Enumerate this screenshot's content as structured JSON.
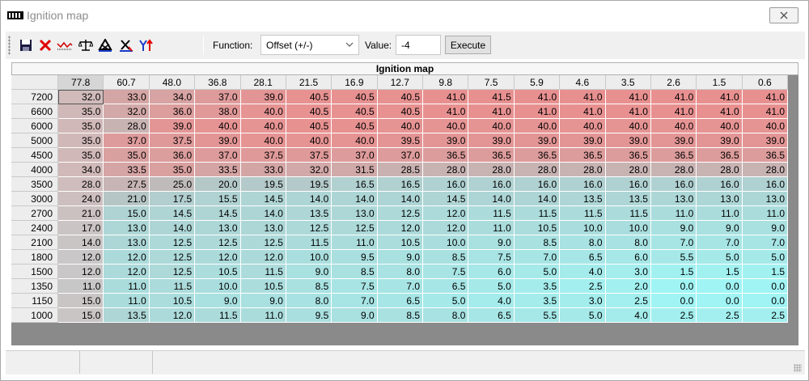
{
  "window": {
    "title": "Ignition map",
    "close_label": "✕"
  },
  "toolbar": {
    "icons": [
      "save-icon",
      "delete-icon",
      "graph-icon",
      "balance-icon",
      "interpolate-x-icon",
      "interpolate-xy-icon",
      "interpolate-y-icon"
    ],
    "function_label": "Function:",
    "function_selected": "Offset (+/-)",
    "value_label": "Value:",
    "value": "-4",
    "execute_label": "Execute"
  },
  "grid": {
    "title": "Ignition map",
    "columns": [
      "77.8",
      "60.7",
      "48.0",
      "36.8",
      "28.1",
      "21.5",
      "16.9",
      "12.7",
      "9.8",
      "7.5",
      "5.9",
      "4.6",
      "3.5",
      "2.6",
      "1.5",
      "0.6"
    ],
    "rows": [
      {
        "rpm": "7200",
        "values": [
          "32.0",
          "33.0",
          "34.0",
          "37.0",
          "39.0",
          "40.5",
          "40.5",
          "40.5",
          "41.0",
          "41.5",
          "41.0",
          "41.0",
          "41.0",
          "41.0",
          "41.0",
          "41.0"
        ]
      },
      {
        "rpm": "6600",
        "values": [
          "35.0",
          "32.0",
          "36.0",
          "38.0",
          "40.0",
          "40.5",
          "40.5",
          "40.5",
          "41.0",
          "41.0",
          "41.0",
          "41.0",
          "41.0",
          "41.0",
          "41.0",
          "41.0"
        ]
      },
      {
        "rpm": "6000",
        "values": [
          "35.0",
          "28.0",
          "39.0",
          "40.0",
          "40.0",
          "40.5",
          "40.5",
          "40.0",
          "40.0",
          "40.0",
          "40.0",
          "40.0",
          "40.0",
          "40.0",
          "40.0",
          "40.0"
        ]
      },
      {
        "rpm": "5000",
        "values": [
          "35.0",
          "37.0",
          "37.5",
          "39.0",
          "40.0",
          "40.0",
          "40.0",
          "39.5",
          "39.0",
          "39.0",
          "39.0",
          "39.0",
          "39.0",
          "39.0",
          "39.0",
          "39.0"
        ]
      },
      {
        "rpm": "4500",
        "values": [
          "35.0",
          "35.0",
          "36.0",
          "37.0",
          "37.5",
          "37.5",
          "37.0",
          "37.0",
          "36.5",
          "36.5",
          "36.5",
          "36.5",
          "36.5",
          "36.5",
          "36.5",
          "36.5"
        ]
      },
      {
        "rpm": "4000",
        "values": [
          "34.0",
          "33.5",
          "35.0",
          "33.5",
          "33.0",
          "32.0",
          "31.5",
          "28.5",
          "28.0",
          "28.0",
          "28.0",
          "28.0",
          "28.0",
          "28.0",
          "28.0",
          "28.0"
        ]
      },
      {
        "rpm": "3500",
        "values": [
          "28.0",
          "27.5",
          "25.0",
          "20.0",
          "19.5",
          "19.5",
          "16.5",
          "16.5",
          "16.0",
          "16.0",
          "16.0",
          "16.0",
          "16.0",
          "16.0",
          "16.0",
          "16.0"
        ]
      },
      {
        "rpm": "3000",
        "values": [
          "24.0",
          "21.0",
          "17.5",
          "15.5",
          "14.5",
          "14.0",
          "14.0",
          "14.0",
          "14.5",
          "14.0",
          "14.0",
          "13.5",
          "13.5",
          "13.0",
          "13.0",
          "13.0"
        ]
      },
      {
        "rpm": "2700",
        "values": [
          "21.0",
          "15.0",
          "14.5",
          "14.5",
          "14.0",
          "13.5",
          "13.0",
          "12.5",
          "12.0",
          "11.5",
          "11.5",
          "11.5",
          "11.5",
          "11.0",
          "11.0",
          "11.0"
        ]
      },
      {
        "rpm": "2400",
        "values": [
          "17.0",
          "13.0",
          "14.0",
          "13.0",
          "13.0",
          "12.5",
          "12.5",
          "12.0",
          "12.0",
          "11.0",
          "10.5",
          "10.0",
          "10.0",
          "9.0",
          "9.0",
          "9.0"
        ]
      },
      {
        "rpm": "2100",
        "values": [
          "14.0",
          "13.0",
          "12.5",
          "12.5",
          "12.5",
          "11.5",
          "11.0",
          "10.5",
          "10.0",
          "9.0",
          "8.5",
          "8.0",
          "8.0",
          "7.0",
          "7.0",
          "7.0"
        ]
      },
      {
        "rpm": "1800",
        "values": [
          "12.0",
          "12.0",
          "12.5",
          "12.0",
          "12.0",
          "10.0",
          "9.5",
          "9.0",
          "8.5",
          "7.5",
          "7.0",
          "6.5",
          "6.0",
          "5.5",
          "5.0",
          "5.0"
        ]
      },
      {
        "rpm": "1500",
        "values": [
          "12.0",
          "12.0",
          "12.5",
          "10.5",
          "11.5",
          "9.0",
          "8.5",
          "8.0",
          "7.5",
          "6.0",
          "5.0",
          "4.0",
          "3.0",
          "1.5",
          "1.5",
          "1.5"
        ]
      },
      {
        "rpm": "1350",
        "values": [
          "11.0",
          "11.0",
          "11.5",
          "10.0",
          "10.5",
          "8.5",
          "7.5",
          "7.0",
          "6.5",
          "5.0",
          "3.5",
          "2.5",
          "2.0",
          "0.0",
          "0.0",
          "0.0"
        ]
      },
      {
        "rpm": "1150",
        "values": [
          "15.0",
          "11.0",
          "10.5",
          "9.0",
          "9.0",
          "8.0",
          "7.0",
          "6.5",
          "5.0",
          "4.0",
          "3.5",
          "3.0",
          "2.5",
          "0.0",
          "0.0",
          "0.0"
        ]
      },
      {
        "rpm": "1000",
        "values": [
          "15.0",
          "13.5",
          "12.0",
          "11.5",
          "11.0",
          "9.5",
          "9.0",
          "8.5",
          "8.0",
          "6.5",
          "5.5",
          "5.0",
          "4.0",
          "2.5",
          "2.5",
          "2.5"
        ]
      }
    ],
    "colors": {
      "high": "#e89090",
      "mid": "#b4c8c8",
      "low": "#a0f4f4",
      "selected_column": "#c8c8c8"
    }
  },
  "statusbar": {
    "segments": [
      "",
      "",
      ""
    ]
  }
}
